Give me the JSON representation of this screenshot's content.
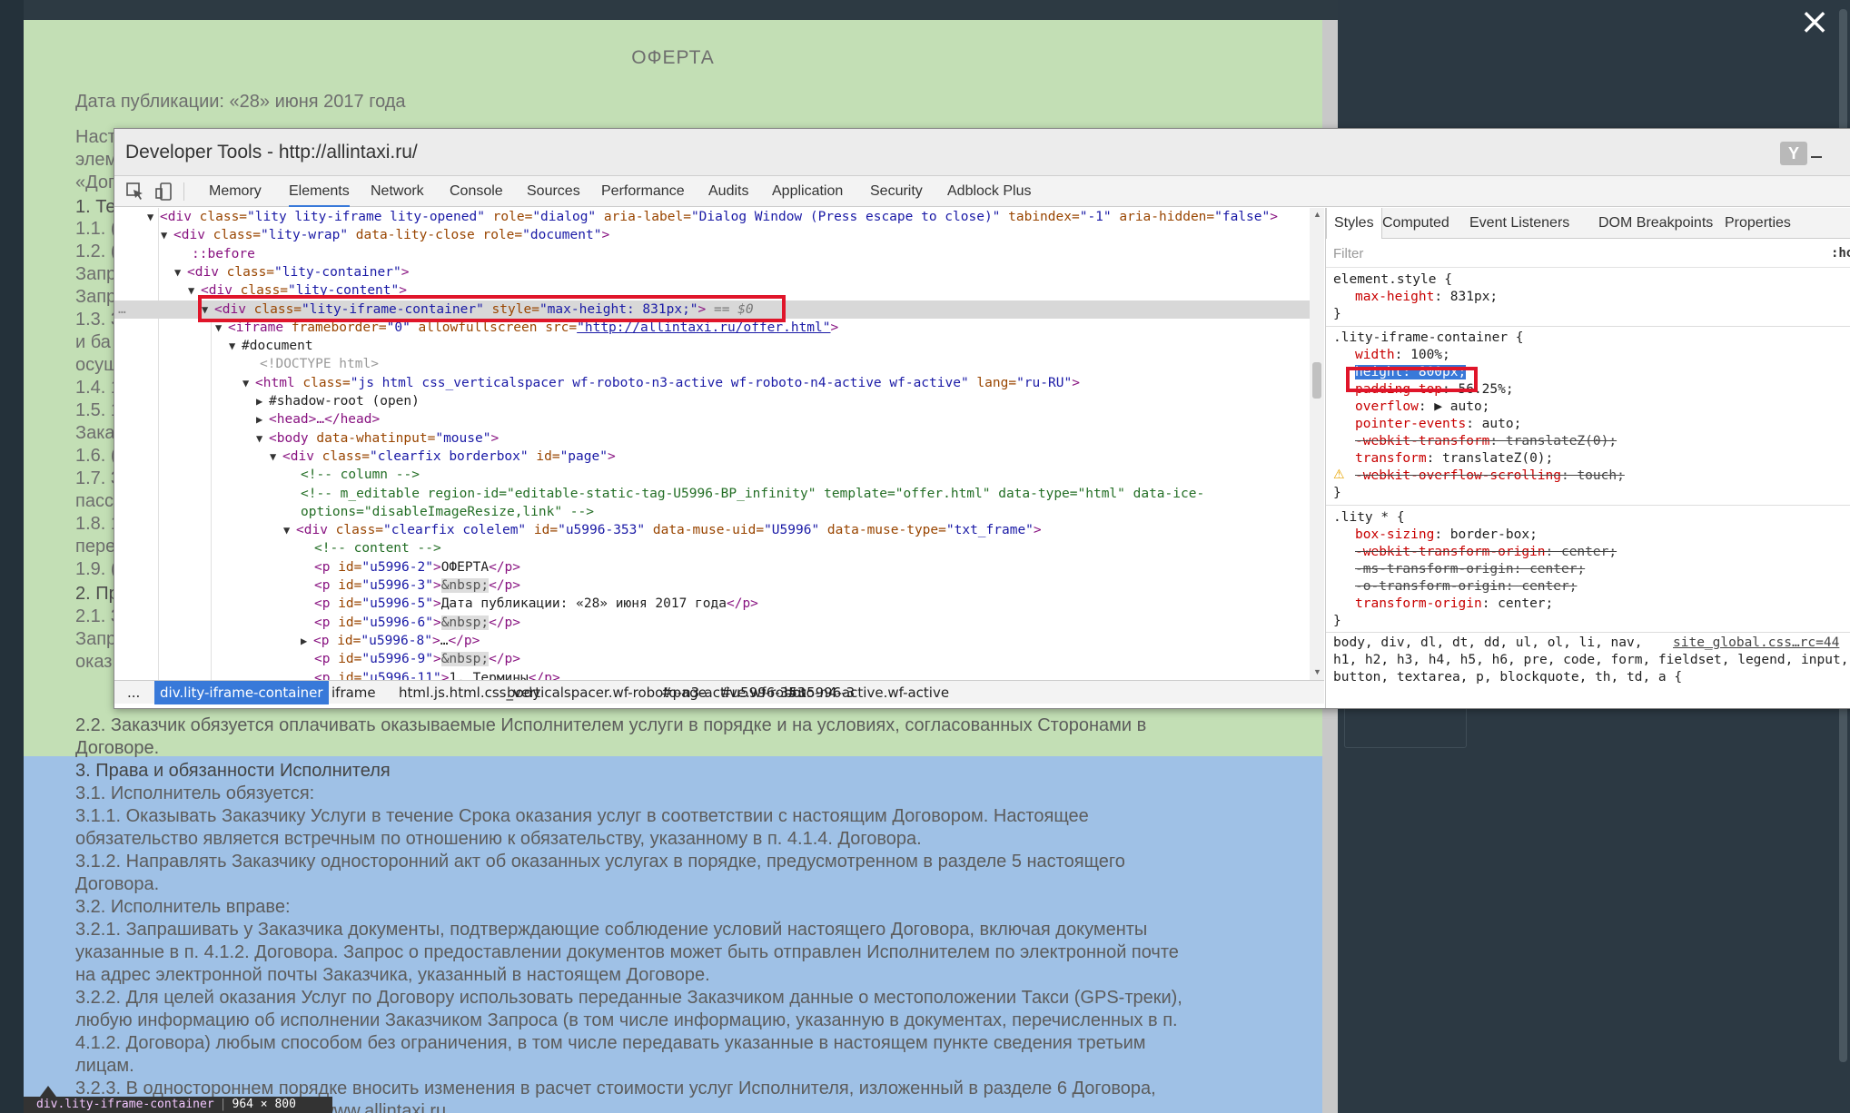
{
  "offer": {
    "title": "ОФЕРТА",
    "publication_date": "Дата публикации: «28» июня 2017 года",
    "left_fragments": [
      "Наст",
      "элем",
      "«Дог",
      "1. Те",
      "1.1. (",
      "1.2. (",
      "Запр",
      "Запр",
      "1.3. 3",
      "и ба",
      "осущ",
      "1.4. 1",
      "1.5. 1",
      "Зака",
      "1.6. (",
      "1.7. 3",
      "пасс",
      "1.8. 1",
      "пере",
      "1.9. (",
      "2. Пр",
      "2.1. 3",
      "Запр",
      "оказ"
    ],
    "lines": [
      {
        "text": "2.2. Заказчик обязуется оплачивать оказываемые Исполнителем услуги в порядке и на условиях, согласованных Сторонами в",
        "h": false
      },
      {
        "text": "Договоре.",
        "h": false
      },
      {
        "text": "3. Права и обязанности Исполнителя",
        "h": true
      },
      {
        "text": "3.1. Исполнитель обязуется:",
        "h": false
      },
      {
        "text": "3.1.1. Оказывать Заказчику Услуги в течение Срока оказания услуг в соответствии с настоящим Договором. Настоящее",
        "h": false
      },
      {
        "text": "обязательство является встречным по отношению к обязательству, указанному в п. 4.1.4. Договора.",
        "h": false
      },
      {
        "text": "3.1.2. Направлять Заказчику односторонний акт об оказанных услугах в порядке, предусмотренном в разделе 5 настоящего",
        "h": false
      },
      {
        "text": "Договора.",
        "h": false
      },
      {
        "text": "3.2. Исполнитель вправе:",
        "h": false
      },
      {
        "text": "3.2.1. Запрашивать у Заказчика документы, подтверждающие соблюдение условий настоящего Договора, включая документы",
        "h": false
      },
      {
        "text": "указанные в п. 4.1.2. Договора. Запрос о предоставлении документов может быть отправлен Исполнителем по электронной почте",
        "h": false
      },
      {
        "text": "на адрес электронной почты Заказчика, указанный в настоящем Договоре.",
        "h": false
      },
      {
        "text": "3.2.2. Для целей оказания Услуг по Договору использовать переданные Заказчиком данные о местоположении Такси (GPS-треки),",
        "h": false
      },
      {
        "text": "любую информацию об исполнении Заказчиком Запроса (в том числе информацию, указанную в документах, перечисленных в п.",
        "h": false
      },
      {
        "text": "4.1.2. Договора) любым способом без ограничения, в том числе передавать указанные в настоящем пункте сведения третьим",
        "h": false
      },
      {
        "text": "лицам.",
        "h": false
      },
      {
        "text": "3.2.3. В одностороннем порядке вносить изменения в расчет стоимости услуг Исполнителя, изложенный в разделе 6 Договора,",
        "h": false
      },
      {
        "text": "вующих изменений на сайте www.allintaxi.ru.",
        "h": false
      }
    ]
  },
  "hover_tooltip": {
    "tag": "div.lity-iframe-container",
    "size": "964 × 800"
  },
  "close_icon": "×",
  "devtools": {
    "title": "Developer Tools - http://allintaxi.ru/",
    "yandex_icon": "Y",
    "tabs": [
      "Memory",
      "Elements",
      "Network",
      "Console",
      "Sources",
      "Performance",
      "Audits",
      "Application",
      "Security",
      "Adblock Plus"
    ],
    "active_tab": "Elements",
    "elements": {
      "l1_tag": "<div",
      "l1_a1": " class=",
      "l1_v1": "\"lity lity-iframe lity-opened\"",
      "l1_a2": " role=",
      "l1_v2": "\"dialog\"",
      "l1_a3": " aria-label=",
      "l1_v3": "\"Dialog Window (Press escape to close)\"",
      "l1_a4": " tabindex=",
      "l1_v4": "\"-1\"",
      "l1_a5": " aria-hidden=",
      "l1_v5": "\"false\"",
      "l1_end": ">",
      "l2_tag": "<div",
      "l2_a1": " class=",
      "l2_v1": "\"lity-wrap\"",
      "l2_a2": " data-lity-close role=",
      "l2_v2": "\"document\"",
      "l2_end": ">",
      "l3": "::before",
      "l4_tag": "<div",
      "l4_a1": " class=",
      "l4_v1": "\"lity-container\"",
      "l4_end": ">",
      "l5_tag": "<div",
      "l5_a1": " class=",
      "l5_v1": "\"lity-content\"",
      "l5_end": ">",
      "l6_tag": "<div",
      "l6_a1": " class=",
      "l6_v1": "\"lity-iframe-container\"",
      "l6_a2": " style=",
      "l6_v2": "\"max-height: 831px;\"",
      "l6_end": ">",
      "l6_eq": " == $0",
      "l7_tag": "<iframe",
      "l7_a1": " frameborder=",
      "l7_v1": "\"0\"",
      "l7_a2": " allowfullscreen src=",
      "l7_v2": "\"http://allintaxi.ru/offer.html\"",
      "l7_end": ">",
      "l8": "#document",
      "l9": "<!DOCTYPE html>",
      "l10_tag": "<html",
      "l10_a1": " class=",
      "l10_v1": "\"js html css_verticalspacer wf-roboto-n3-active wf-roboto-n4-active wf-active\"",
      "l10_a2": " lang=",
      "l10_v2": "\"ru-RU\"",
      "l10_end": ">",
      "l11": "#shadow-root (open)",
      "l12": "<head>…</head>",
      "l13_tag": "<body",
      "l13_a1": " data-whatinput=",
      "l13_v1": "\"mouse\"",
      "l13_end": ">",
      "l14_tag": "<div",
      "l14_a1": " class=",
      "l14_v1": "\"clearfix borderbox\"",
      "l14_a2": " id=",
      "l14_v2": "\"page\"",
      "l14_end": ">",
      "l15": "<!-- column -->",
      "l16": "<!-- m_editable region-id=\"editable-static-tag-U5996-BP_infinity\" template=\"offer.html\" data-type=\"html\" data-ice-",
      "l17": "options=\"disableImageResize,link\" -->",
      "l18_tag": "<div",
      "l18_a1": " class=",
      "l18_v1": "\"clearfix colelem\"",
      "l18_a2": " id=",
      "l18_v2": "\"u5996-353\"",
      "l18_a3": " data-muse-uid=",
      "l18_v3": "\"U5996\"",
      "l18_a4": " data-muse-type=",
      "l18_v4": "\"txt_frame\"",
      "l18_end": ">",
      "l19": "<!-- content -->",
      "p_rows": [
        {
          "id": "\"u5996-2\"",
          "text": "ОФЕРТА",
          "nbsp": false,
          "collapsed": false
        },
        {
          "id": "\"u5996-3\"",
          "text": "&nbsp;",
          "nbsp": true,
          "collapsed": false
        },
        {
          "id": "\"u5996-5\"",
          "text": "Дата публикации: «28» июня 2017 года",
          "nbsp": false,
          "collapsed": false
        },
        {
          "id": "\"u5996-6\"",
          "text": "&nbsp;",
          "nbsp": true,
          "collapsed": false
        },
        {
          "id": "\"u5996-8\"",
          "text": "…",
          "nbsp": false,
          "collapsed": true
        },
        {
          "id": "\"u5996-9\"",
          "text": "&nbsp;",
          "nbsp": true,
          "collapsed": false
        },
        {
          "id": "\"u5996-11\"",
          "text": "1. Термины",
          "nbsp": false,
          "collapsed": false
        }
      ],
      "p_open": "<p",
      "p_id_attr": " id=",
      "p_gt": ">",
      "p_close": "</p>",
      "ellipsis": "…"
    },
    "breadcrumbs": [
      "...",
      "div.lity-iframe-container",
      "iframe",
      "html.js.html.css_verticalspacer.wf-roboto-n3-active.wf-roboto-n4-active.wf-active",
      "body",
      "#page",
      "#u5996-353",
      "#u5996-3"
    ],
    "styles": {
      "tabs": [
        "Styles",
        "Computed",
        "Event Listeners",
        "DOM Breakpoints",
        "Properties"
      ],
      "filter_placeholder": "Filter",
      "hov": ":ho",
      "rules": {
        "r1_sel": "element.style {",
        "r1_p1_n": "max-height",
        "r1_p1_v": ": 831px;",
        "close": "}",
        "r2_sel": ".lity-iframe-container {",
        "r2_src": "(",
        "r2_p1_n": "width",
        "r2_p1_v": ": 100%;",
        "r2_p2_n": "height",
        "r2_p2_v": ": 800px;",
        "r2_p3_n": "padding-top",
        "r2_p3_v": ": 56.25%;",
        "r2_p4_n": "overflow",
        "r2_p4_v": ": ▶ auto;",
        "r2_p5_n": "pointer-events",
        "r2_p5_v": ": auto;",
        "r2_p6_n": "-webkit-transform",
        "r2_p6_v": ": translateZ(0);",
        "r2_p7_n": "transform",
        "r2_p7_v": ": translateZ(0);",
        "r2_p8_n": "-webkit-overflow-scrolling",
        "r2_p8_v": ": touch;",
        "r3_sel": ".lity * {",
        "r3_src": "(",
        "r3_p1_n": "box-sizing",
        "r3_p1_v": ": border-box;",
        "r3_p2_n": "-webkit-transform-origin",
        "r3_p2_v": ": center;",
        "r3_p3_n": "-ms-transform-origin",
        "r3_p3_v": ": center;",
        "r3_p4_n": "-o-transform-origin",
        "r3_p4_v": ": center;",
        "r3_p5_n": "transform-origin",
        "r3_p5_v": ": center;",
        "r4_l1": "body, div, dl, dt, dd, ul, ol, li, nav,",
        "r4_src": "site_global.css…rc=44",
        "r4_l2": "h1, h2, h3, h4, h5, h6, pre, code, form, fieldset, legend, input,",
        "r4_l3": "button, textarea, p, blockquote, th, td, a {",
        "warn_icon": "⚠"
      }
    }
  },
  "colors": {
    "highlight_box": "#e0152a",
    "offer_green": "#c3dfb5",
    "offer_blue": "#9fc1e6",
    "accent": "#3879d9"
  }
}
